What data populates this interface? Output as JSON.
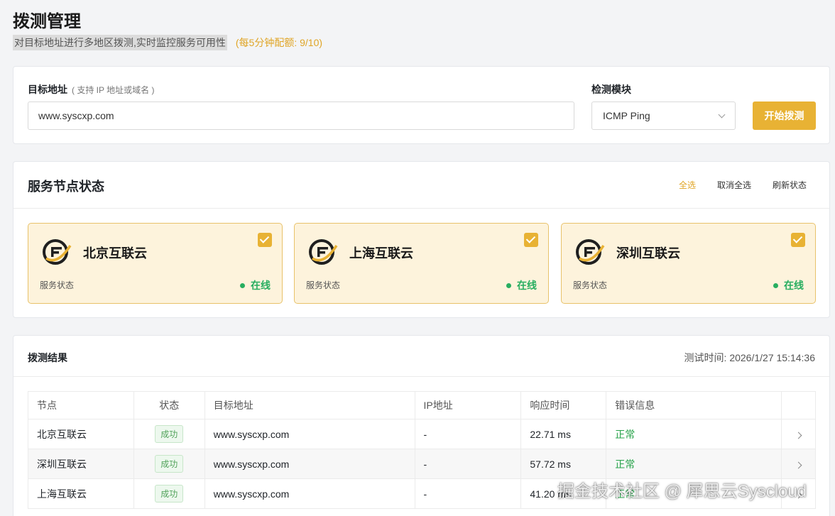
{
  "header": {
    "title": "拨测管理",
    "subtitle": "对目标地址进行多地区拨测,实时监控服务可用性",
    "quota": "(每5分钟配额: 9/10)"
  },
  "form": {
    "target_label": "目标地址",
    "target_hint": "( 支持 IP 地址或域名 )",
    "target_value": "www.syscxp.com",
    "module_label": "检测模块",
    "module_value": "ICMP Ping",
    "start_button": "开始拨测"
  },
  "nodes": {
    "title": "服务节点状态",
    "select_all": "全选",
    "deselect_all": "取消全选",
    "refresh": "刷新状态",
    "items": [
      {
        "name": "北京互联云",
        "status_label": "服务状态",
        "status": "在线",
        "checked": true
      },
      {
        "name": "上海互联云",
        "status_label": "服务状态",
        "status": "在线",
        "checked": true
      },
      {
        "name": "深圳互联云",
        "status_label": "服务状态",
        "status": "在线",
        "checked": true
      }
    ],
    "colors": {
      "accent": "#e8b234",
      "online": "#27ae60"
    }
  },
  "results": {
    "title": "拨测结果",
    "test_time": "测试时间: 2026/1/27 15:14:36",
    "columns": [
      "节点",
      "状态",
      "目标地址",
      "IP地址",
      "响应时间",
      "错误信息"
    ],
    "rows": [
      {
        "node": "北京互联云",
        "status": "成功",
        "target": "www.syscxp.com",
        "ip": "-",
        "time": "22.71 ms",
        "error": "正常"
      },
      {
        "node": "深圳互联云",
        "status": "成功",
        "target": "www.syscxp.com",
        "ip": "-",
        "time": "57.72 ms",
        "error": "正常"
      },
      {
        "node": "上海互联云",
        "status": "成功",
        "target": "www.syscxp.com",
        "ip": "-",
        "time": "41.20 ms",
        "error": "正常"
      }
    ]
  },
  "watermark": "掘金技术社区 @ 犀思云Syscloud"
}
